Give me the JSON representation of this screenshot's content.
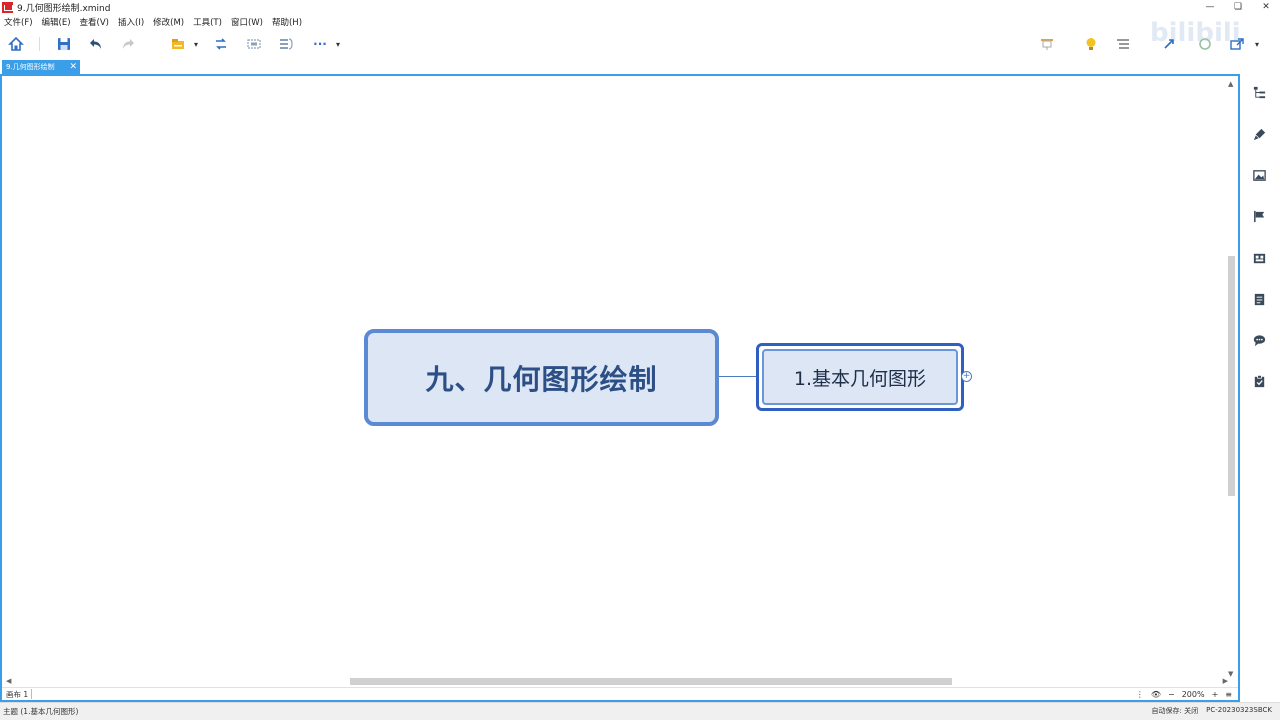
{
  "window": {
    "title": "9.几何图形绘制.xmind",
    "controls": {
      "minimize": "—",
      "restore": "❏",
      "close": "✕"
    }
  },
  "menu": [
    "文件(F)",
    "编辑(E)",
    "查看(V)",
    "插入(I)",
    "修改(M)",
    "工具(T)",
    "窗口(W)",
    "帮助(H)"
  ],
  "toolbar": {
    "icons": [
      "home-icon",
      "save-icon",
      "undo-icon",
      "redo-icon",
      "folder-icon",
      "relationship-icon",
      "boundary-icon",
      "summary-icon",
      "more-icon"
    ],
    "more_label": "···",
    "dropdown": "▾"
  },
  "watermark": "bilibili",
  "tab": {
    "label": "9.几何图形绘制",
    "close": "✕"
  },
  "mindmap": {
    "central_topic": "九、几何图形绘制",
    "subtopics": [
      "1.基本几何图形"
    ],
    "expand_symbol": "+"
  },
  "status": {
    "sheet": "画布 1",
    "zoom": "200%",
    "zoom_out": "−",
    "zoom_in": "+"
  },
  "bottom": {
    "left": "主题 (1.基本几何图形)",
    "autosave": "自动保存: 关闭",
    "machine": "PC-20230323SBCK"
  },
  "colors": {
    "accent": "#3a9ee8",
    "topic_border": "#5b89d4",
    "topic_fill": "#dde6f5",
    "topic_text": "#2c4f86"
  }
}
